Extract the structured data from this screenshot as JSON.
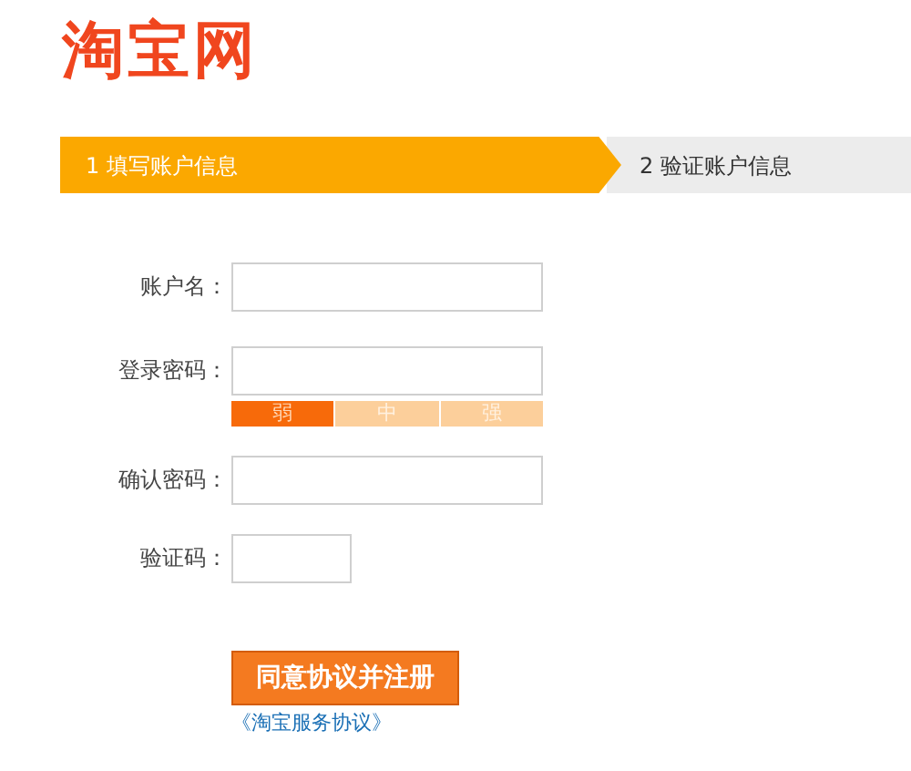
{
  "logo": "淘宝网",
  "steps": [
    {
      "label": "1 填写账户信息",
      "selected": true
    },
    {
      "label": "2 验证账户信息",
      "selected": false
    }
  ],
  "fields": [
    {
      "kind": "text",
      "label": "账户名："
    },
    {
      "kind": "password",
      "label": "登录密码："
    },
    {
      "kind": "password",
      "label": "确认密码："
    },
    {
      "kind": "captcha",
      "label": "验证码："
    }
  ],
  "strength": [
    {
      "label": "弱",
      "selected": true
    },
    {
      "label": "中",
      "selected": false
    },
    {
      "label": "强",
      "selected": false
    }
  ],
  "submit_button": "同意协议并注册",
  "agreement_link": "《淘宝服务协议》"
}
